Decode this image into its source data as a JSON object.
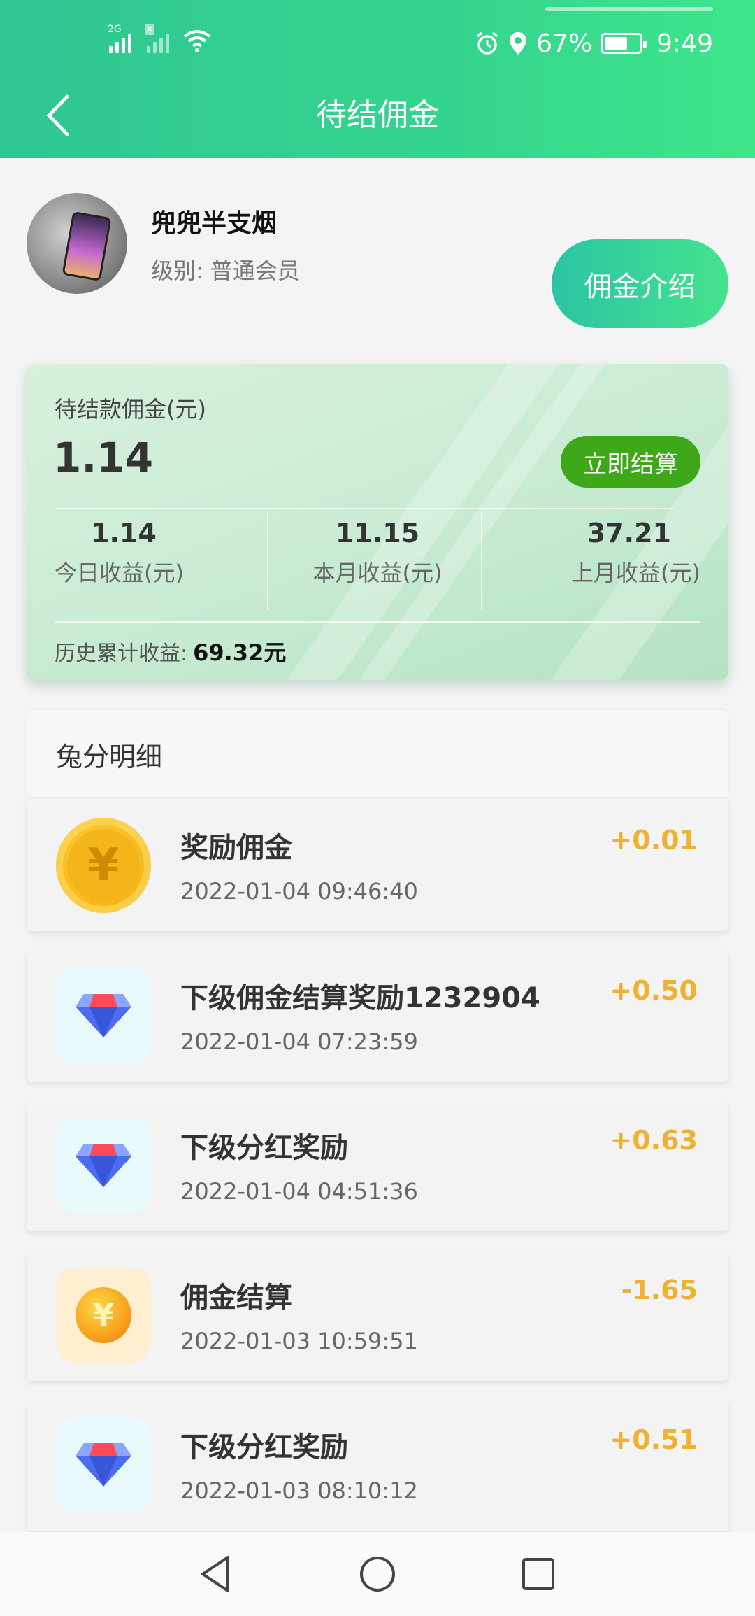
{
  "status_bar": {
    "network_tag": "2G",
    "sim2_tag": "×",
    "battery": "67%",
    "time": "9:49"
  },
  "nav": {
    "title": "待结佣金"
  },
  "profile": {
    "name": "兜兜半支烟",
    "level_label": "级别:",
    "level_value": "普通会员",
    "intro_button": "佣金介绍"
  },
  "summary": {
    "pending_label": "待结款佣金(元)",
    "pending_amount": "1.14",
    "settle_button": "立即结算",
    "stats": [
      {
        "value": "1.14",
        "label": "今日收益(元)"
      },
      {
        "value": "11.15",
        "label": "本月收益(元)"
      },
      {
        "value": "37.21",
        "label": "上月收益(元)"
      }
    ],
    "history_label": "历史累计收益:",
    "history_value": "69.32元"
  },
  "details": {
    "header": "兔分明细",
    "items": [
      {
        "title": "奖励佣金",
        "time": "2022-01-04 09:46:40",
        "amount": "+0.01",
        "icon": "yen-coin-icon"
      },
      {
        "title": "下级佣金结算奖励1232904",
        "time": "2022-01-04 07:23:59",
        "amount": "+0.50",
        "icon": "diamond-icon"
      },
      {
        "title": "下级分红奖励",
        "time": "2022-01-04 04:51:36",
        "amount": "+0.63",
        "icon": "diamond-icon"
      },
      {
        "title": "佣金结算",
        "time": "2022-01-03 10:59:51",
        "amount": "-1.65",
        "icon": "yen-coin-small-icon"
      },
      {
        "title": "下级分红奖励",
        "time": "2022-01-03 08:10:12",
        "amount": "+0.51",
        "icon": "diamond-icon"
      }
    ]
  },
  "colors": {
    "header_green": "#35d48e",
    "settle_green": "#3ea818",
    "amount_orange": "#f0b030"
  }
}
